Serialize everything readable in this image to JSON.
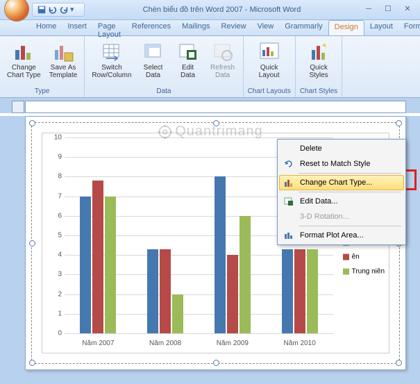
{
  "title": "Chèn biểu đồ trên Word 2007 - Microsoft Word",
  "tabs": [
    "Home",
    "Insert",
    "Page Layout",
    "References",
    "Mailings",
    "Review",
    "View",
    "Grammarly",
    "Design",
    "Layout",
    "Format"
  ],
  "active_tab": "Design",
  "ribbon": {
    "type": {
      "change": "Change\nChart Type",
      "save": "Save As\nTemplate",
      "label": "Type"
    },
    "data": {
      "switch": "Switch\nRow/Column",
      "select": "Select\nData",
      "edit": "Edit\nData",
      "refresh": "Refresh\nData",
      "label": "Data"
    },
    "layouts": {
      "quick": "Quick\nLayout",
      "label": "Chart Layouts"
    },
    "styles": {
      "quick": "Quick\nStyles",
      "label": "Chart Styles"
    }
  },
  "chart_data": {
    "type": "bar",
    "categories": [
      "Năm 2007",
      "Năm 2008",
      "Năm 2009",
      "Năm 2010"
    ],
    "series": [
      {
        "name": "",
        "values": [
          7,
          4.3,
          8,
          4.3
        ],
        "color": "#4678b0"
      },
      {
        "name": "ên",
        "values": [
          7.8,
          4.3,
          4,
          4.3
        ],
        "color": "#b64a48"
      },
      {
        "name": "Trung niên",
        "values": [
          7,
          2,
          6,
          4.3
        ],
        "color": "#9bbb59"
      }
    ],
    "ylim": [
      0,
      10
    ],
    "yticks": [
      0,
      1,
      2,
      3,
      4,
      5,
      6,
      7,
      8,
      9,
      10
    ]
  },
  "context_menu": {
    "delete": "Delete",
    "reset": "Reset to Match Style",
    "change": "Change Chart Type...",
    "edit": "Edit Data...",
    "rot": "3-D Rotation...",
    "fmt": "Format Plot Area..."
  },
  "watermark": "Quantrimang"
}
